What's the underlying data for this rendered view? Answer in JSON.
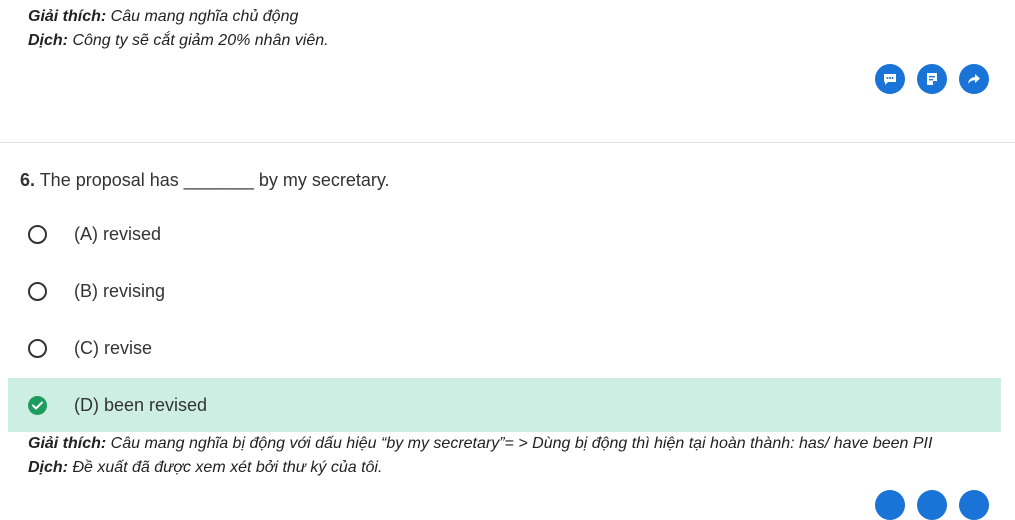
{
  "prev_explanation": {
    "explain_label": "Giải thích:",
    "explain_text": " Câu mang nghĩa chủ động",
    "translate_label": "Dịch:",
    "translate_text": " Công ty sẽ cắt giảm 20% nhân viên."
  },
  "actions": {
    "icons": [
      "comment-icon",
      "note-icon",
      "share-icon"
    ],
    "color": "#1a73d6"
  },
  "question": {
    "number": "6.",
    "text": " The proposal has _______ by my secretary."
  },
  "options": [
    {
      "label": "(A) revised",
      "selected": false
    },
    {
      "label": "(B) revising",
      "selected": false
    },
    {
      "label": "(C) revise",
      "selected": false
    },
    {
      "label": "(D) been revised",
      "selected": true
    }
  ],
  "explanation": {
    "explain_label": "Giải thích:",
    "explain_text": " Câu mang nghĩa bị động với dấu hiệu “by my secretary”= > Dùng bị động thì hiện tại hoàn thành: has/ have been PII",
    "translate_label": "Dịch:",
    "translate_text": " Đề xuất đã được xem xét bởi thư ký của tôi."
  },
  "colors": {
    "accent": "#1a73d6",
    "correct_bg": "#cdeee2",
    "correct_check": "#1c9c5d"
  }
}
